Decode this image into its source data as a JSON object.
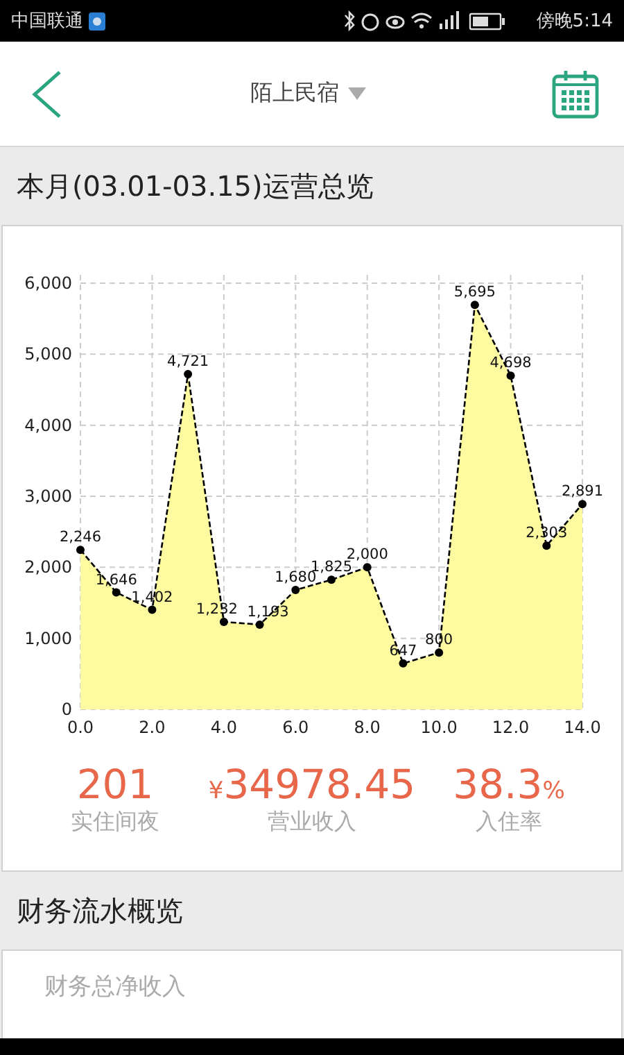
{
  "status_bar": {
    "carrier": "中国联通",
    "time": "傍晚5:14"
  },
  "header": {
    "title": "陌上民宿"
  },
  "overview": {
    "title": "本月(03.01-03.15)运营总览",
    "chart_data": {
      "type": "area",
      "x": [
        0,
        1,
        2,
        3,
        4,
        5,
        6,
        7,
        8,
        9,
        10,
        11,
        12,
        13,
        14
      ],
      "grid": true,
      "series": [
        {
          "color": "#fdfa9f",
          "values": [
            2246,
            1646,
            1402,
            4721,
            1232,
            1193,
            1680,
            1825,
            2000,
            647,
            800,
            5695,
            4698,
            2303,
            2891
          ]
        }
      ],
      "value_labels": [
        "2,246",
        "1,646",
        "1,402",
        "4,721",
        "1,232",
        "1,193",
        "1,680",
        "1,825",
        "2,000",
        "647",
        "800",
        "5,695",
        "4,698",
        "2,303",
        "2,891"
      ],
      "xlim": [
        0,
        14
      ],
      "ylim": [
        0,
        6000
      ],
      "xticks": [
        {
          "value": 0,
          "label": "0.0"
        },
        {
          "value": 2,
          "label": "2.0"
        },
        {
          "value": 4,
          "label": "4.0"
        },
        {
          "value": 6,
          "label": "6.0"
        },
        {
          "value": 8,
          "label": "8.0"
        },
        {
          "value": 10,
          "label": "10.0"
        },
        {
          "value": 12,
          "label": "12.0"
        },
        {
          "value": 14,
          "label": "14.0"
        }
      ],
      "yticks": [
        {
          "value": 0,
          "label": "0"
        },
        {
          "value": 1000,
          "label": "1,000"
        },
        {
          "value": 2000,
          "label": "2,000"
        },
        {
          "value": 3000,
          "label": "3,000"
        },
        {
          "value": 4000,
          "label": "4,000"
        },
        {
          "value": 5000,
          "label": "5,000"
        },
        {
          "value": 6000,
          "label": "6,000"
        }
      ]
    },
    "stats": [
      {
        "value": "201",
        "label": "实住间夜"
      },
      {
        "prefix": "¥",
        "value": "34978.45",
        "label": "营业收入"
      },
      {
        "value": "38.3",
        "suffix": "%",
        "label": "入住率"
      }
    ]
  },
  "finance": {
    "title": "财务流水概览",
    "first_item": "财务总净收入"
  }
}
